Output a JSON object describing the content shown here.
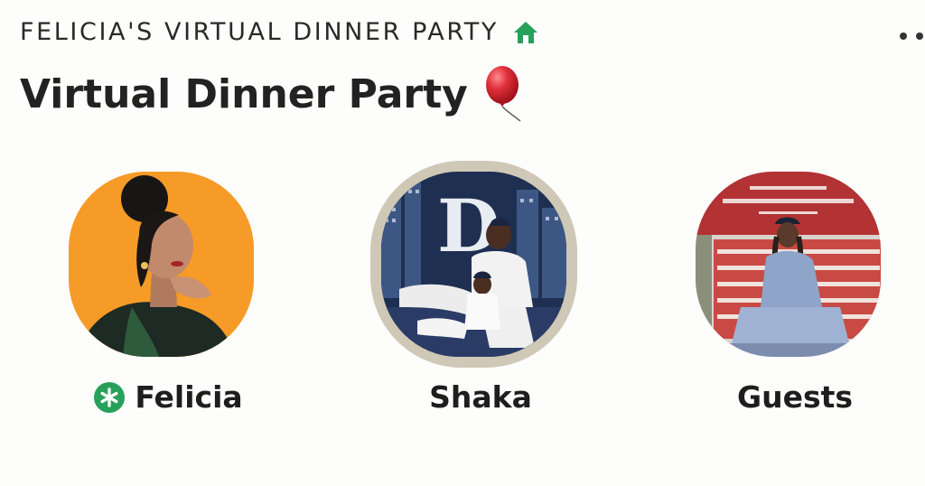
{
  "header": {
    "club_name": "FELICIA'S VIRTUAL DINNER PARTY",
    "club_icon": "house-icon",
    "more_icon": "more-dots-icon"
  },
  "room": {
    "title": "Virtual Dinner Party",
    "title_emoji": "balloon-icon"
  },
  "speakers": [
    {
      "name": "Felicia",
      "badge": "moderator-star-icon",
      "speaking": false
    },
    {
      "name": "Shaka",
      "badge": "",
      "speaking": true
    },
    {
      "name": "Guests",
      "badge": "",
      "speaking": false
    }
  ],
  "colors": {
    "accent_green": "#27a05a",
    "speaking_ring": "#cfc8b6",
    "balloon_red": "#e0303a"
  }
}
